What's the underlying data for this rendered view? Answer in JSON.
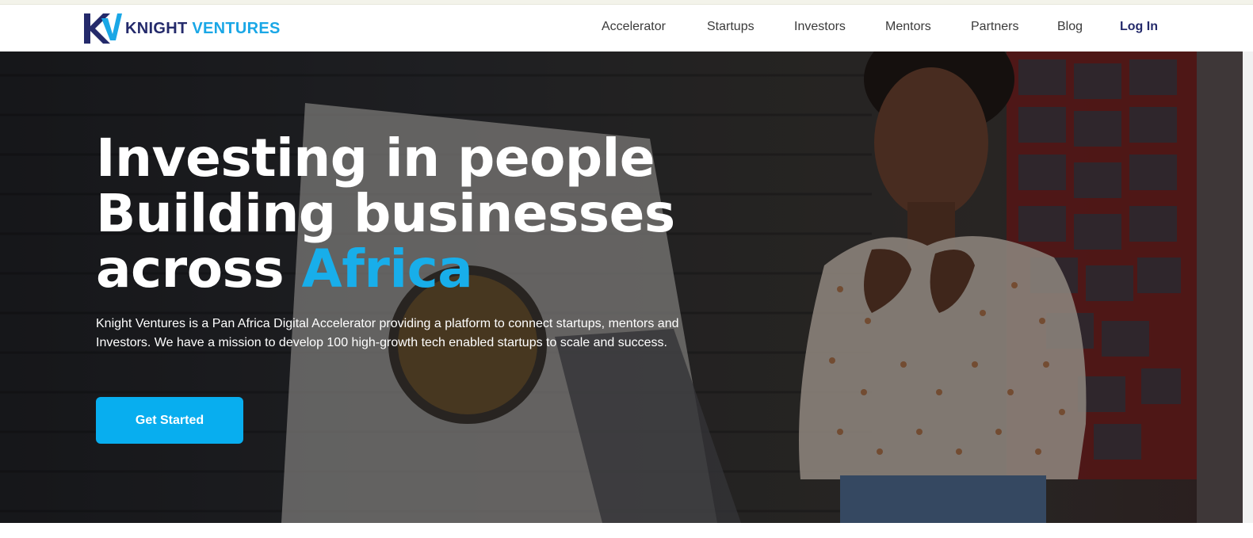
{
  "brand": {
    "name_part1": "KNIGHT",
    "name_part2": "VENTURES",
    "colors": {
      "navy": "#242a6b",
      "blue": "#1aa7e6"
    }
  },
  "nav": {
    "items": [
      {
        "label": "Accelerator"
      },
      {
        "label": "Startups"
      },
      {
        "label": "Investors"
      },
      {
        "label": "Mentors"
      },
      {
        "label": "Partners"
      },
      {
        "label": "Blog"
      }
    ],
    "login_label": "Log In"
  },
  "hero": {
    "title_line1": "Investing in people",
    "title_line2": "Building businesses",
    "title_line3_plain": "across ",
    "title_line3_accent": "Africa",
    "description": "Knight Ventures is a Pan Africa Digital Accelerator providing a platform to connect startups, mentors and Investors. We have a mission to develop 100 high-growth tech enabled startups to scale and success.",
    "cta_label": "Get Started",
    "accent_color": "#18aeea",
    "cta_color": "#08aeef"
  }
}
